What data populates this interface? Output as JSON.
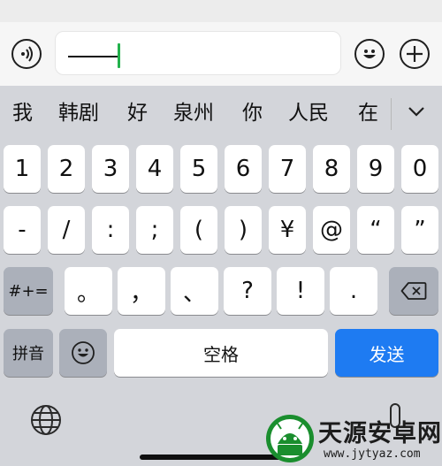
{
  "candidates": [
    "我",
    "韩剧",
    "好",
    "泉州",
    "你",
    "人民",
    "在"
  ],
  "row_digits": [
    "1",
    "2",
    "3",
    "4",
    "5",
    "6",
    "7",
    "8",
    "9",
    "0"
  ],
  "row_symbols": [
    "-",
    "/",
    ":",
    ";",
    "(",
    ")",
    "¥",
    "@",
    "“",
    "”"
  ],
  "row_punct": {
    "mode_key": "#+=",
    "keys": [
      "。",
      "，",
      "、",
      "?",
      "!",
      "."
    ]
  },
  "bottom_row": {
    "pinyin": "拼音",
    "space": "空格",
    "send": "发送"
  },
  "input": {
    "text": "——"
  },
  "watermark": {
    "title": "天源安卓网",
    "url": "www.jytyaz.com"
  },
  "colors": {
    "accent": "#1e7bf2",
    "caret": "#22b14c"
  }
}
